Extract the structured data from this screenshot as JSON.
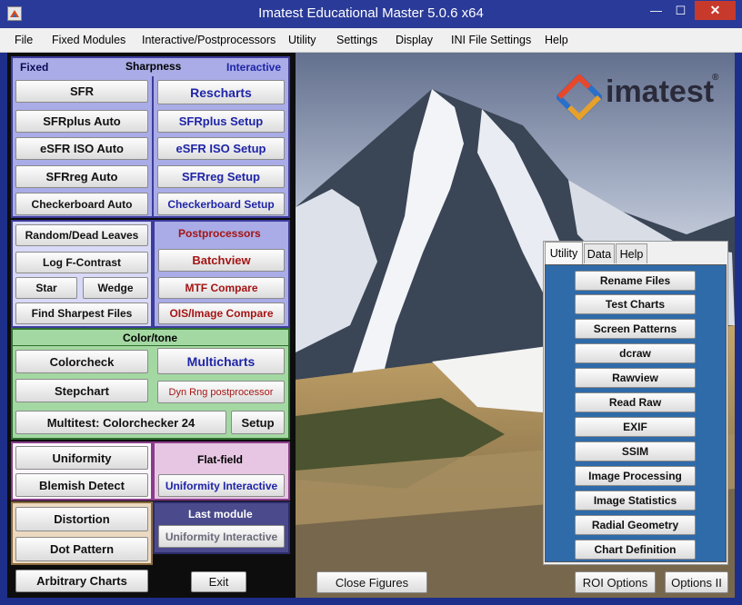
{
  "window": {
    "title": "Imatest Educational Master 5.0.6 x64",
    "minimize_glyph": "—",
    "maximize_glyph": "☐",
    "close_glyph": "✕"
  },
  "menu": [
    "File",
    "Fixed Modules",
    "Interactive/Postprocessors",
    "Utility",
    "Settings",
    "Display",
    "INI File Settings",
    "Help"
  ],
  "sharpness": {
    "fixed_label": "Fixed",
    "header": "Sharpness",
    "interactive_label": "Interactive",
    "fixed_buttons": [
      "SFR",
      "SFRplus Auto",
      "eSFR ISO Auto",
      "SFRreg Auto",
      "Checkerboard Auto"
    ],
    "interactive_buttons": [
      "Rescharts",
      "SFRplus Setup",
      "eSFR ISO Setup",
      "SFRreg Setup",
      "Checkerboard Setup"
    ]
  },
  "misc": {
    "random_dead_leaves": "Random/Dead Leaves",
    "log_f_contrast": "Log F-Contrast",
    "star": "Star",
    "wedge": "Wedge",
    "find_sharpest": "Find Sharpest Files"
  },
  "postprocessors": {
    "header": "Postprocessors",
    "batchview": "Batchview",
    "mtf_compare": "MTF Compare",
    "ois_compare": "OIS/Image Compare"
  },
  "colortone": {
    "header": "Color/tone",
    "colorcheck": "Colorcheck",
    "stepchart": "Stepchart",
    "multicharts": "Multicharts",
    "dyn_rng": "Dyn Rng postprocessor",
    "multitest": "Multitest:  Colorchecker 24",
    "setup": "Setup"
  },
  "uniformity": {
    "uniformity": "Uniformity",
    "blemish": "Blemish Detect",
    "flatfield_header": "Flat-field",
    "uniformity_interactive": "Uniformity Interactive"
  },
  "distortion": {
    "distortion": "Distortion",
    "dot_pattern": "Dot Pattern"
  },
  "last_module": {
    "header": "Last module",
    "value": "Uniformity Interactive"
  },
  "bottom": {
    "arbitrary_charts": "Arbitrary Charts",
    "exit": "Exit",
    "close_figures": "Close Figures",
    "roi_options": "ROI Options",
    "options_ii": "Options II"
  },
  "logo": {
    "text": "imatest",
    "registered": "®"
  },
  "utility_panel": {
    "tabs": [
      "Utility",
      "Data",
      "Help"
    ],
    "active_tab": "Utility",
    "buttons": [
      "Rename Files",
      "Test Charts",
      "Screen Patterns",
      "dcraw",
      "Rawview",
      "Read Raw",
      "EXIF",
      "SSIM",
      "Image Processing",
      "Image Statistics",
      "Radial Geometry",
      "Chart Definition"
    ]
  },
  "colors": {
    "titlebar": "#2a3a98",
    "sharpness_bg": "#a9ace6",
    "misc_bg": "#d9d9f7",
    "postproc_bg": "#a9ace6",
    "colortone_bg": "#a4d8a2",
    "uniformity_bg": "#e6c6e2",
    "distortion_bg": "#ecd9c1",
    "lastmodule_bg": "#4a4a8c",
    "utility_body": "#2f6aa9"
  }
}
